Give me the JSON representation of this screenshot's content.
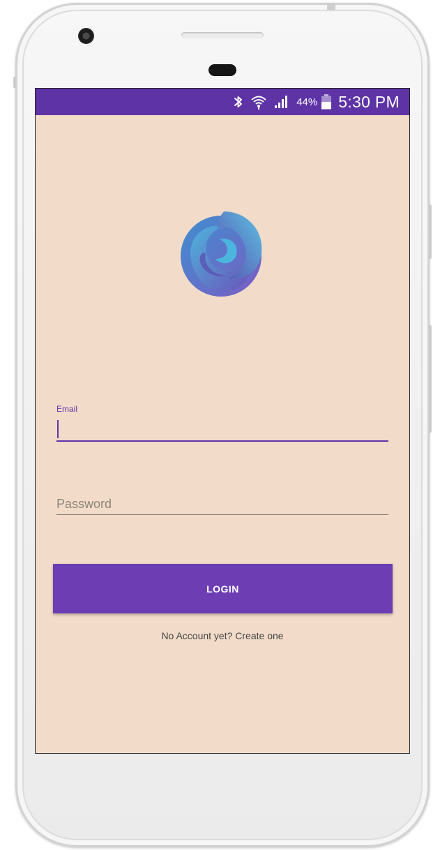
{
  "status_bar": {
    "battery_percent": "44%",
    "time": "5:30 PM",
    "icons": [
      "bluetooth-icon",
      "wifi-icon",
      "signal-icon",
      "battery-icon"
    ],
    "color": "#5e33a6"
  },
  "app": {
    "logo": "app-logo",
    "background_color": "#f2dcc9",
    "accent_color": "#6d3eb3"
  },
  "login_form": {
    "email": {
      "label": "Email",
      "value": ""
    },
    "password": {
      "placeholder": "Password",
      "value": ""
    },
    "login_button": "LOGIN",
    "create_account_link": "No Account yet? Create one"
  }
}
